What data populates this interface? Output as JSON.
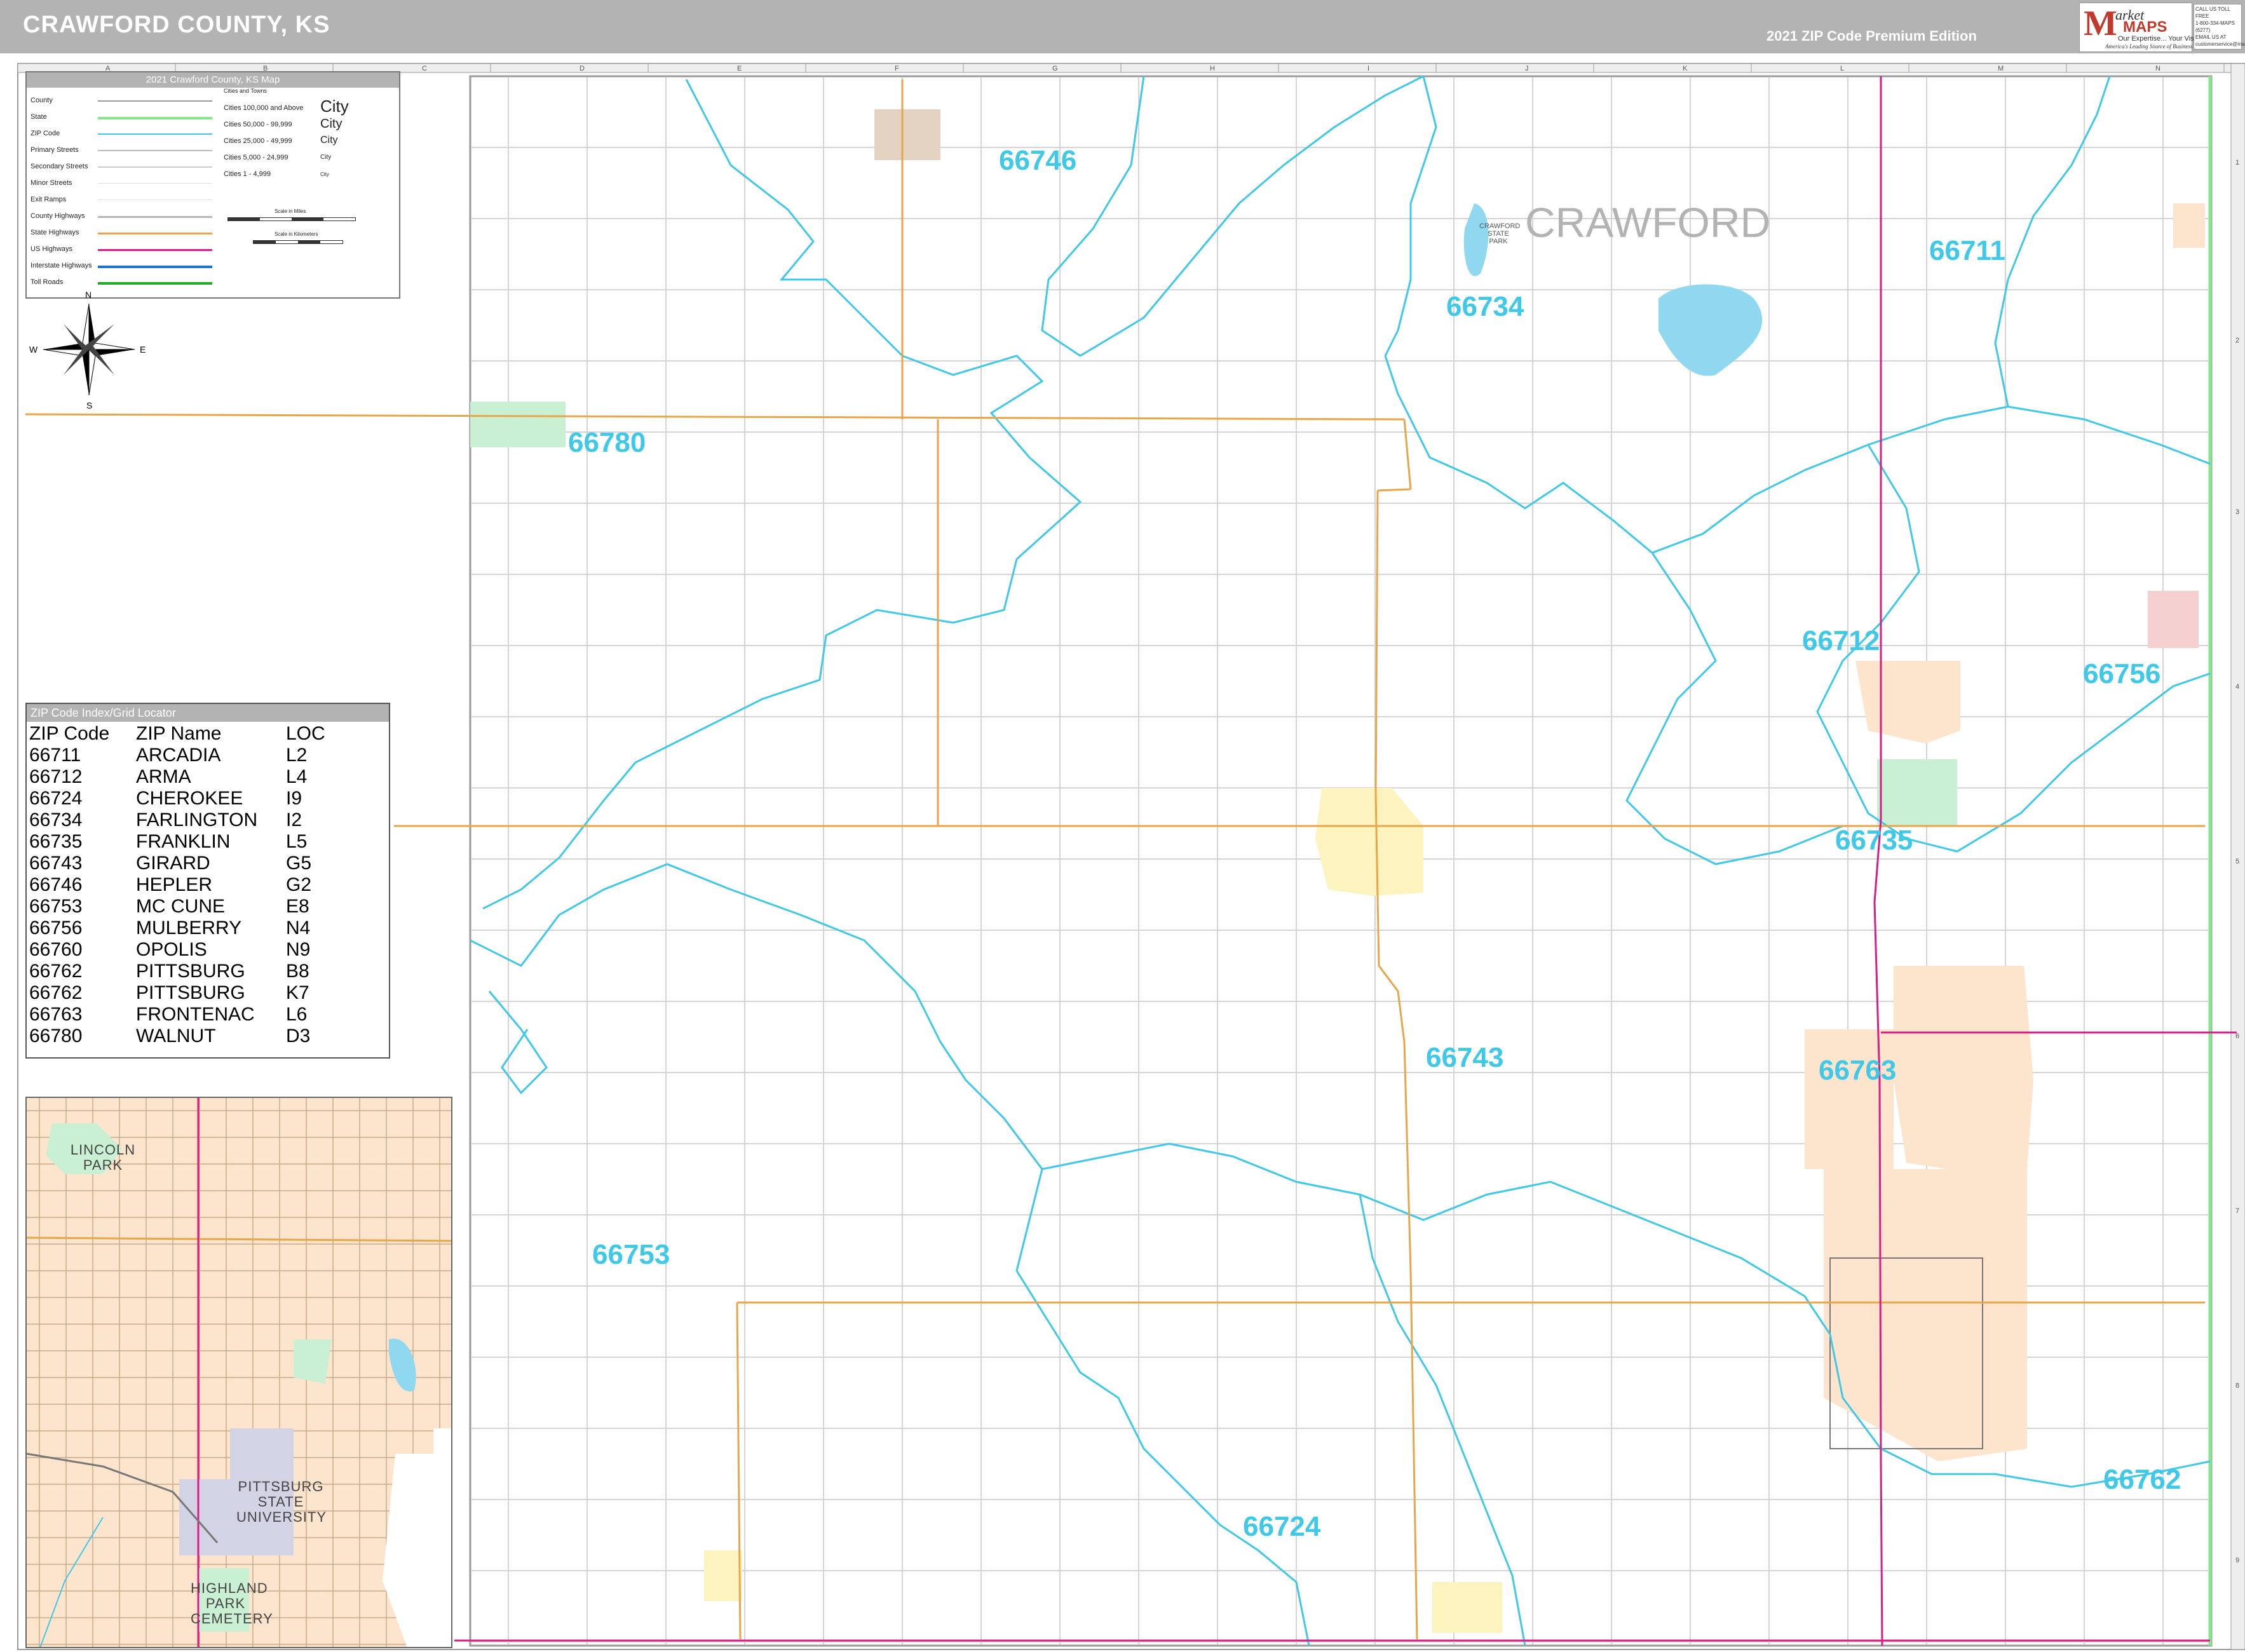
{
  "header": {
    "title": "CRAWFORD COUNTY, KS",
    "edition": "2021 ZIP Code Premium Edition",
    "logo": {
      "letter": "M",
      "word1": "arket",
      "word2": "MAPS",
      "tagline": "Our Expertise... Your Vision.",
      "slogan": "America's Leading Source of Business Maps"
    },
    "contact": [
      "CALL US TOLL FREE",
      "1-800-334-MAPS (6277)",
      "EMAIL US AT",
      "customerservice@marketmaps.com"
    ]
  },
  "county_label": "CRAWFORD",
  "legend": {
    "title": "2021 Crawford County, KS Map",
    "items": [
      "County",
      "State",
      "ZIP Code",
      "Primary Streets",
      "Secondary Streets",
      "Minor Streets",
      "Exit Ramps",
      "County Highways",
      "State Highways",
      "US Highways",
      "Interstate Highways",
      "Toll Roads"
    ],
    "colors": {
      "county": "#9a9a9a",
      "state": "#86e68e",
      "zip": "#3fc8e8",
      "primary": "#bbbbbb",
      "secondary": "#cccccc",
      "minor": "#dddddd",
      "exit": "#dddddd",
      "county_hwy": "#b7b7b7",
      "state_hwy": "#e8a64a",
      "us_hwy": "#d61e8a",
      "interstate": "#1e6fd6",
      "toll": "#22aa22"
    },
    "cities_heading": "Cities and Towns",
    "cities": [
      {
        "range": "Cities 100,000 and Above",
        "sample": "City"
      },
      {
        "range": "Cities 50,000 - 99,999",
        "sample": "City"
      },
      {
        "range": "Cities 25,000 - 49,999",
        "sample": "City"
      },
      {
        "range": "Cities 5,000 - 24,999",
        "sample": "City"
      },
      {
        "range": "Cities 1 - 4,999",
        "sample": "City"
      }
    ],
    "scale_miles": "Scale in Miles",
    "scale_km": "Scale in Kilometers"
  },
  "compass": {
    "n": "N",
    "s": "S",
    "e": "E",
    "w": "W"
  },
  "zip_index": {
    "title": "ZIP Code Index/Grid Locator",
    "headers": [
      "ZIP Code",
      "ZIP Name",
      "LOC"
    ],
    "rows": [
      [
        "66711",
        "ARCADIA",
        "L2"
      ],
      [
        "66712",
        "ARMA",
        "L4"
      ],
      [
        "66724",
        "CHEROKEE",
        "I9"
      ],
      [
        "66734",
        "FARLINGTON",
        "I2"
      ],
      [
        "66735",
        "FRANKLIN",
        "L5"
      ],
      [
        "66743",
        "GIRARD",
        "G5"
      ],
      [
        "66746",
        "HEPLER",
        "G2"
      ],
      [
        "66753",
        "MC CUNE",
        "E8"
      ],
      [
        "66756",
        "MULBERRY",
        "N4"
      ],
      [
        "66760",
        "OPOLIS",
        "N9"
      ],
      [
        "66762",
        "PITTSBURG",
        "B8"
      ],
      [
        "66762",
        "PITTSBURG",
        "K7"
      ],
      [
        "66763",
        "FRONTENAC",
        "L6"
      ],
      [
        "66780",
        "WALNUT",
        "D3"
      ]
    ]
  },
  "zip_labels": [
    {
      "code": "66746"
    },
    {
      "code": "66734"
    },
    {
      "code": "66711"
    },
    {
      "code": "66780"
    },
    {
      "code": "66712"
    },
    {
      "code": "66756"
    },
    {
      "code": "66735"
    },
    {
      "code": "66743"
    },
    {
      "code": "66763"
    },
    {
      "code": "66753"
    },
    {
      "code": "66724"
    },
    {
      "code": "66762"
    }
  ],
  "park_label": "CRAWFORD STATE PARK",
  "grid_cols": [
    "A",
    "B",
    "C",
    "D",
    "E",
    "F",
    "G",
    "H",
    "I",
    "J",
    "K",
    "L",
    "M",
    "N"
  ],
  "grid_rows": [
    "1",
    "2",
    "3",
    "4",
    "5",
    "6",
    "7",
    "8",
    "9"
  ],
  "inset": {
    "lincoln_park": "LINCOLN PARK",
    "university": "PITTSBURG STATE UNIVERSITY",
    "cemetery": "HIGHLAND PARK CEMETERY"
  }
}
